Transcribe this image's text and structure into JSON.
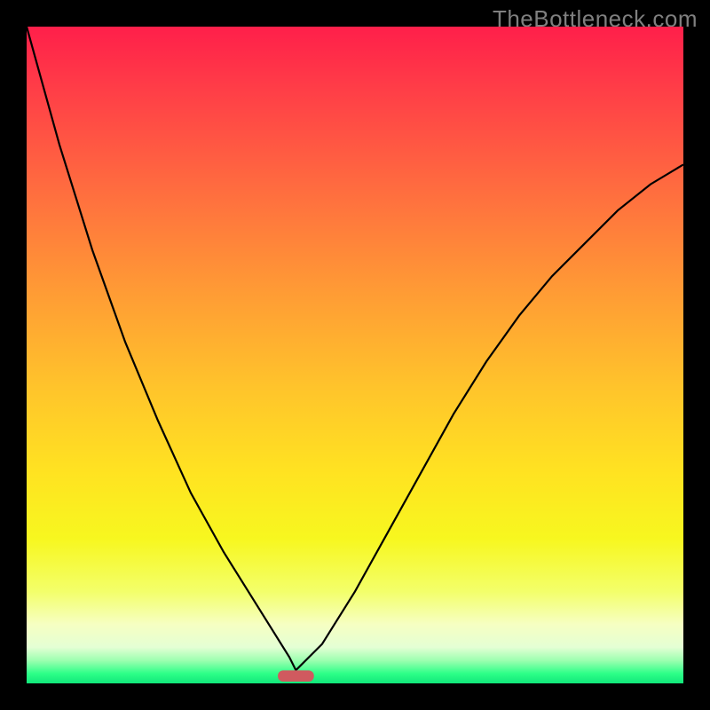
{
  "watermark": "TheBottleneck.com",
  "chart_data": {
    "type": "line",
    "title": "",
    "xlabel": "",
    "ylabel": "",
    "xlim": [
      0,
      100
    ],
    "ylim": [
      0,
      100
    ],
    "grid": false,
    "legend": false,
    "note": "V-shaped bottleneck curve over a vertical red-to-green gradient. Minimum near x≈41. Values are estimated from pixel position.",
    "x": [
      0,
      5,
      10,
      15,
      20,
      25,
      30,
      35,
      40,
      41,
      45,
      50,
      55,
      60,
      65,
      70,
      75,
      80,
      85,
      90,
      95,
      100
    ],
    "y": [
      100,
      82,
      66,
      52,
      40,
      29,
      20,
      12,
      4,
      2,
      6,
      14,
      23,
      32,
      41,
      49,
      56,
      62,
      67,
      72,
      76,
      79
    ],
    "marker": {
      "x_center": 41,
      "width": 5.5,
      "height": 1.7,
      "color": "#d05a5f"
    },
    "gradient_stops": [
      {
        "offset": 0.0,
        "color": "#ff1f4a"
      },
      {
        "offset": 0.1,
        "color": "#ff3f47"
      },
      {
        "offset": 0.25,
        "color": "#ff6d3f"
      },
      {
        "offset": 0.4,
        "color": "#ff9a35"
      },
      {
        "offset": 0.55,
        "color": "#ffc42b"
      },
      {
        "offset": 0.68,
        "color": "#ffe321"
      },
      {
        "offset": 0.78,
        "color": "#f7f71f"
      },
      {
        "offset": 0.86,
        "color": "#f3ff6a"
      },
      {
        "offset": 0.91,
        "color": "#f6ffc2"
      },
      {
        "offset": 0.945,
        "color": "#e4ffd4"
      },
      {
        "offset": 0.965,
        "color": "#9dffb0"
      },
      {
        "offset": 0.985,
        "color": "#2dff88"
      },
      {
        "offset": 1.0,
        "color": "#11e77a"
      }
    ]
  }
}
